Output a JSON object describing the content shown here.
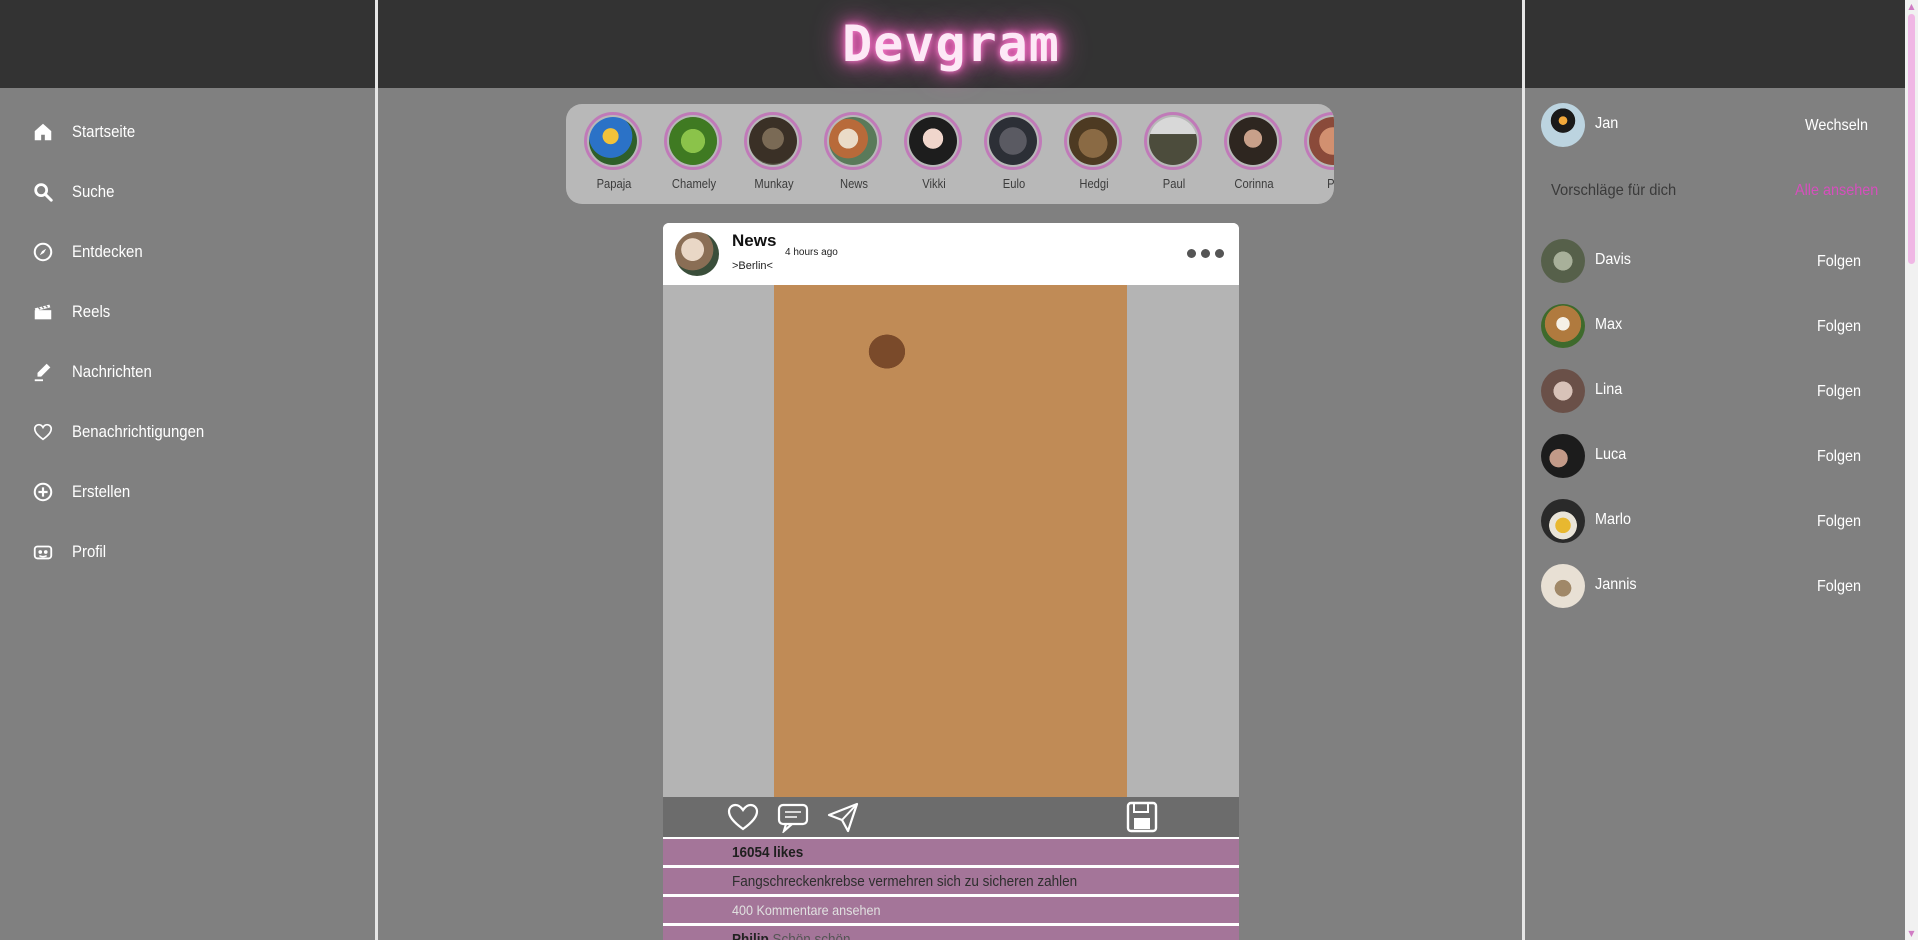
{
  "app": {
    "title": "Devgram"
  },
  "colors": {
    "accent": "#d64fbd",
    "story_ring": "#c07ab8",
    "post_row": "#a47599",
    "header": "#333333",
    "background": "#808080"
  },
  "nav": {
    "items": [
      {
        "label": "Startseite",
        "icon": "home-icon"
      },
      {
        "label": "Suche",
        "icon": "search-icon"
      },
      {
        "label": "Entdecken",
        "icon": "compass-icon"
      },
      {
        "label": "Reels",
        "icon": "clapper-icon"
      },
      {
        "label": "Nachrichten",
        "icon": "pen-icon"
      },
      {
        "label": "Benachrichtigungen",
        "icon": "heart-icon"
      },
      {
        "label": "Erstellen",
        "icon": "plus-circle-icon"
      },
      {
        "label": "Profil",
        "icon": "profile-icon"
      }
    ]
  },
  "stories": [
    {
      "name": "Papaja"
    },
    {
      "name": "Chamely"
    },
    {
      "name": "Munkay"
    },
    {
      "name": "News"
    },
    {
      "name": "Vikki"
    },
    {
      "name": "Eulo"
    },
    {
      "name": "Hedgi"
    },
    {
      "name": "Paul"
    },
    {
      "name": "Corinna"
    },
    {
      "name": "Ph"
    }
  ],
  "post": {
    "user": "News",
    "location": ">Berlin<",
    "time": "4 hours ago",
    "likes": "16054 likes",
    "caption": "Fangschreckenkrebse vermehren sich zu sicheren zahlen",
    "comments_link": "400 Kommentare ansehen",
    "first_comment_user": "Philip",
    "first_comment_text": "Schön schön"
  },
  "account": {
    "name": "Jan",
    "switch_label": "Wechseln"
  },
  "suggestions": {
    "title": "Vorschläge für dich",
    "see_all": "Alle ansehen",
    "follow_label": "Folgen",
    "users": [
      {
        "name": "Davis"
      },
      {
        "name": "Max"
      },
      {
        "name": "Lina"
      },
      {
        "name": "Luca"
      },
      {
        "name": "Marlo"
      },
      {
        "name": "Jannis"
      }
    ]
  }
}
